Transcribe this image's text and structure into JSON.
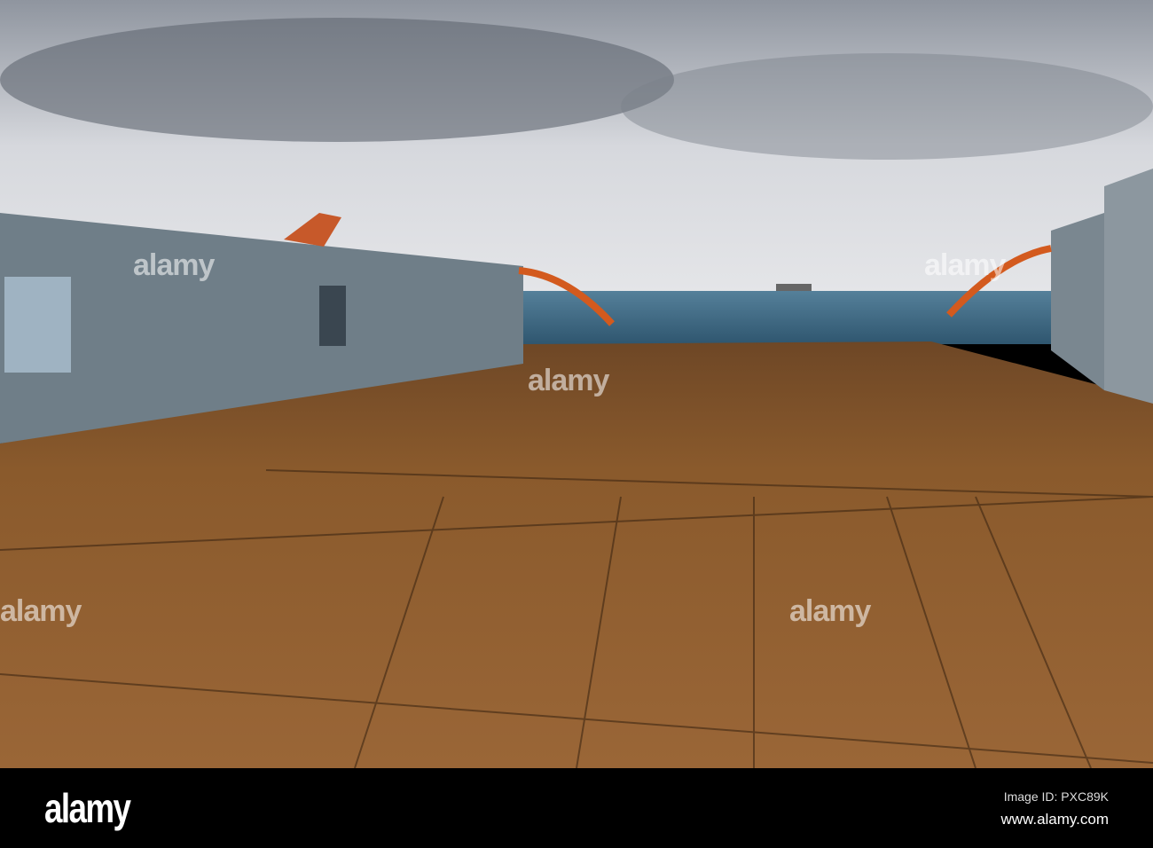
{
  "footer": {
    "brand": "alamy",
    "image_id": "Image ID: PXC89K",
    "url": "www.alamy.com"
  },
  "watermark": "alamy",
  "colors": {
    "sky": "#c9ccd3",
    "sea": "#3e6a85",
    "deck": "#8a5a2c",
    "hull": "#6f7e88",
    "rails": "#d35a1e"
  }
}
